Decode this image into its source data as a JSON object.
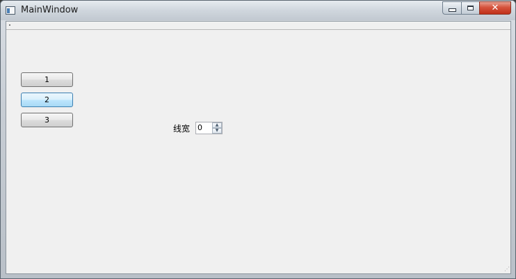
{
  "window": {
    "title": "MainWindow",
    "close_label": "✕"
  },
  "buttons": [
    {
      "label": "1"
    },
    {
      "label": "2"
    },
    {
      "label": "3"
    }
  ],
  "line_width": {
    "label": "线宽",
    "value": "0"
  },
  "icons": {
    "app": "app-window-icon",
    "minimize": "minimize-icon",
    "maximize": "maximize-icon",
    "close": "close-icon",
    "spin_up": "chevron-up-icon",
    "spin_down": "chevron-down-icon",
    "size_grip": "resize-grip-icon"
  },
  "colors": {
    "client_background": "#f0f0f0",
    "close_button": "#c0301a",
    "focused_button": "#bee6fd"
  }
}
